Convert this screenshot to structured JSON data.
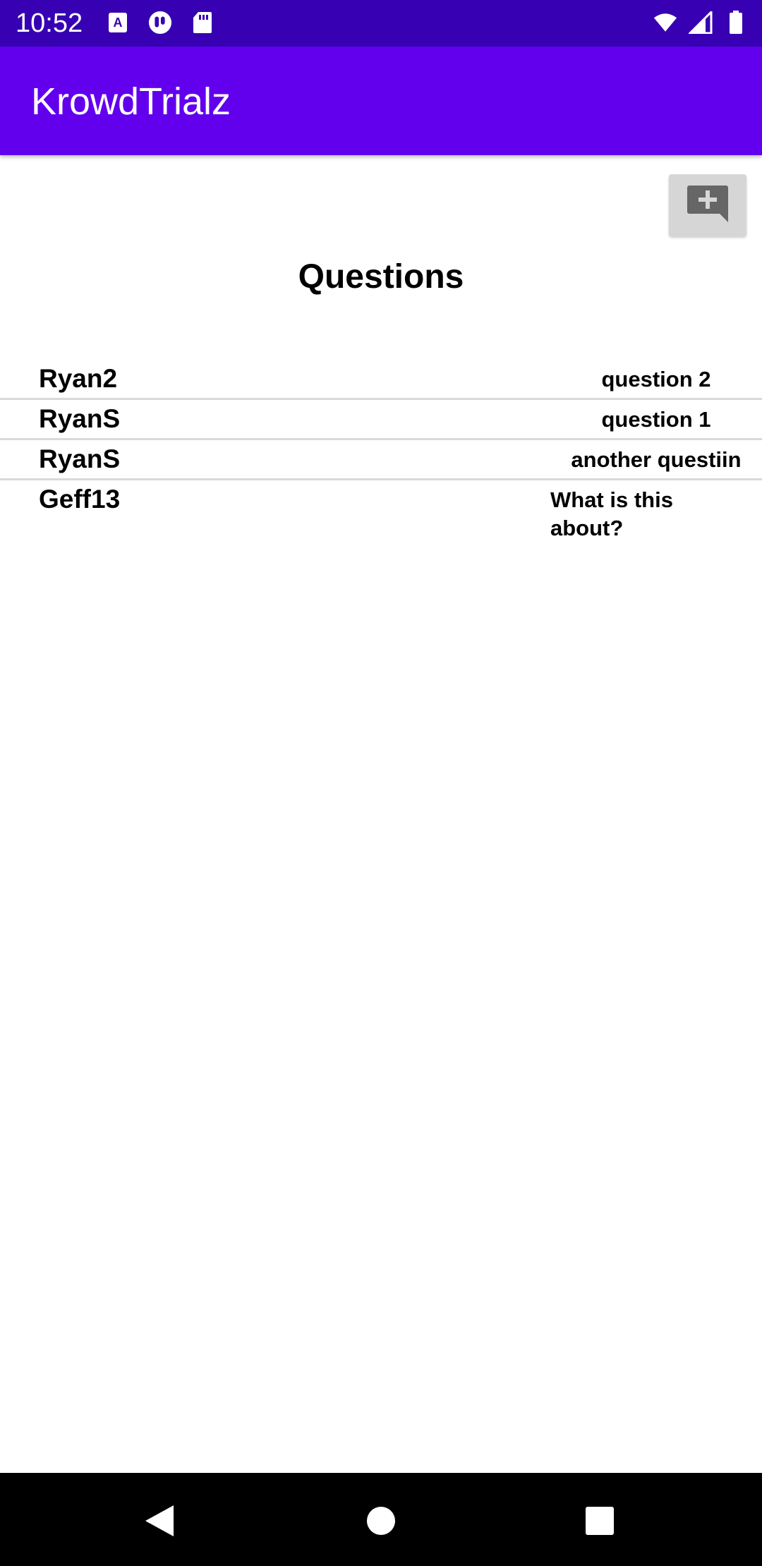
{
  "status_bar": {
    "time": "10:52",
    "left_icons": [
      "a-icon",
      "vpn-icon",
      "sd-card-icon"
    ],
    "right_icons": [
      "wifi-icon",
      "signal-icon",
      "battery-icon"
    ]
  },
  "app_bar": {
    "title": "KrowdTrialz"
  },
  "add_button": {
    "icon": "add-comment-icon"
  },
  "page": {
    "title": "Questions"
  },
  "questions": [
    {
      "user": "Ryan2",
      "question": "question 2"
    },
    {
      "user": "RyanS",
      "question": "question 1"
    },
    {
      "user": "RyanS",
      "question": "another questiin"
    },
    {
      "user": "Geff13",
      "question": "What is this about?"
    }
  ],
  "nav_bar": {
    "buttons": [
      "back-icon",
      "home-icon",
      "recents-icon"
    ]
  },
  "colors": {
    "status_bar": "#3700B3",
    "app_bar": "#6200EE",
    "add_button_bg": "#d6d6d6"
  }
}
